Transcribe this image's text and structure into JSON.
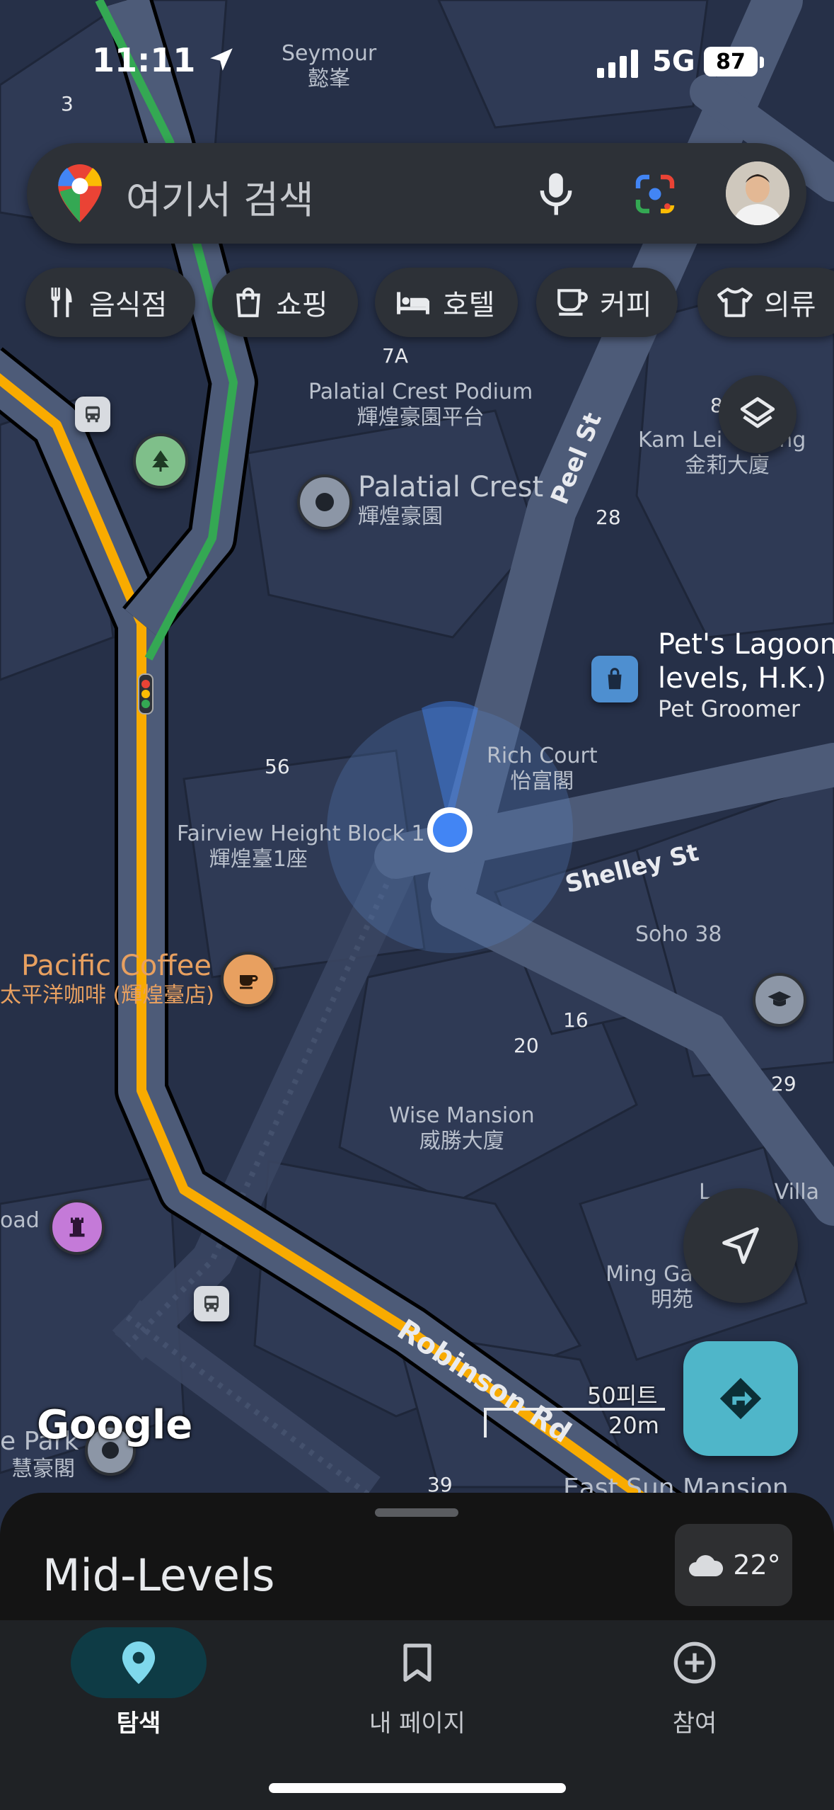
{
  "status_bar": {
    "time": "11:11",
    "network": "5G",
    "battery": "87"
  },
  "search": {
    "placeholder": "여기서 검색"
  },
  "chips": [
    {
      "label": "음식점",
      "icon": "fork-knife-icon"
    },
    {
      "label": "쇼핑",
      "icon": "shopping-bag-icon"
    },
    {
      "label": "호텔",
      "icon": "bed-icon"
    },
    {
      "label": "커피",
      "icon": "coffee-cup-icon"
    },
    {
      "label": "의류",
      "icon": "shirt-icon"
    }
  ],
  "map": {
    "places": {
      "seymour_en": "Seymour",
      "seymour_zh": "懿峯",
      "podium_en": "Palatial Crest Podium",
      "podium_zh": "輝煌豪園平台",
      "palatial_en": "Palatial Crest",
      "palatial_zh": "輝煌豪園",
      "kam_en": "Kam Lei",
      "kam_en2": "ng",
      "kam_zh": "金莉大廈",
      "rich_en": "Rich Court",
      "rich_zh": "怡富閣",
      "fairview_en": "Fairview Height Block 1",
      "fairview_zh": "輝煌臺1座",
      "pacific_en": "Pacific Coffee",
      "pacific_zh": "太平洋咖啡 (輝煌臺店)",
      "soho": "Soho 38",
      "wise_en": "Wise Mansion",
      "wise_zh": "威勝大廈",
      "ming_en": "Ming Ga",
      "ming_zh": "明苑",
      "villa": "Villa",
      "villa_partial": "L",
      "road_left": "oad",
      "park_left": "e Park",
      "park_zh": "慧豪閣",
      "east_sun": "East Sun Mansion",
      "pets_line1": "Pet's Lagoon",
      "pets_line2": "levels, H.K.) -",
      "pets_sub": "Pet Groomer"
    },
    "numbers": {
      "n3": "3",
      "n7a": "7A",
      "n8": "8",
      "n28": "28",
      "n56": "56",
      "n16": "16",
      "n20": "20",
      "n29": "29",
      "n39": "39"
    },
    "roads": {
      "peel": "Peel St",
      "shelley": "Shelley St",
      "robinson": "Robinson Rd"
    },
    "scale": {
      "feet": "50피트",
      "meters": "20m"
    },
    "logo": "Google",
    "colors": {
      "traffic_orange": "#f9ab00",
      "traffic_green": "#34a853",
      "location_blue": "#4285f4"
    }
  },
  "sheet": {
    "area": "Mid-Levels",
    "temperature": "22°"
  },
  "bottom_nav": [
    {
      "label": "탐색",
      "icon": "location-pin-icon",
      "active": true
    },
    {
      "label": "내 페이지",
      "icon": "bookmark-icon",
      "active": false
    },
    {
      "label": "참여",
      "icon": "plus-circle-icon",
      "active": false
    }
  ]
}
